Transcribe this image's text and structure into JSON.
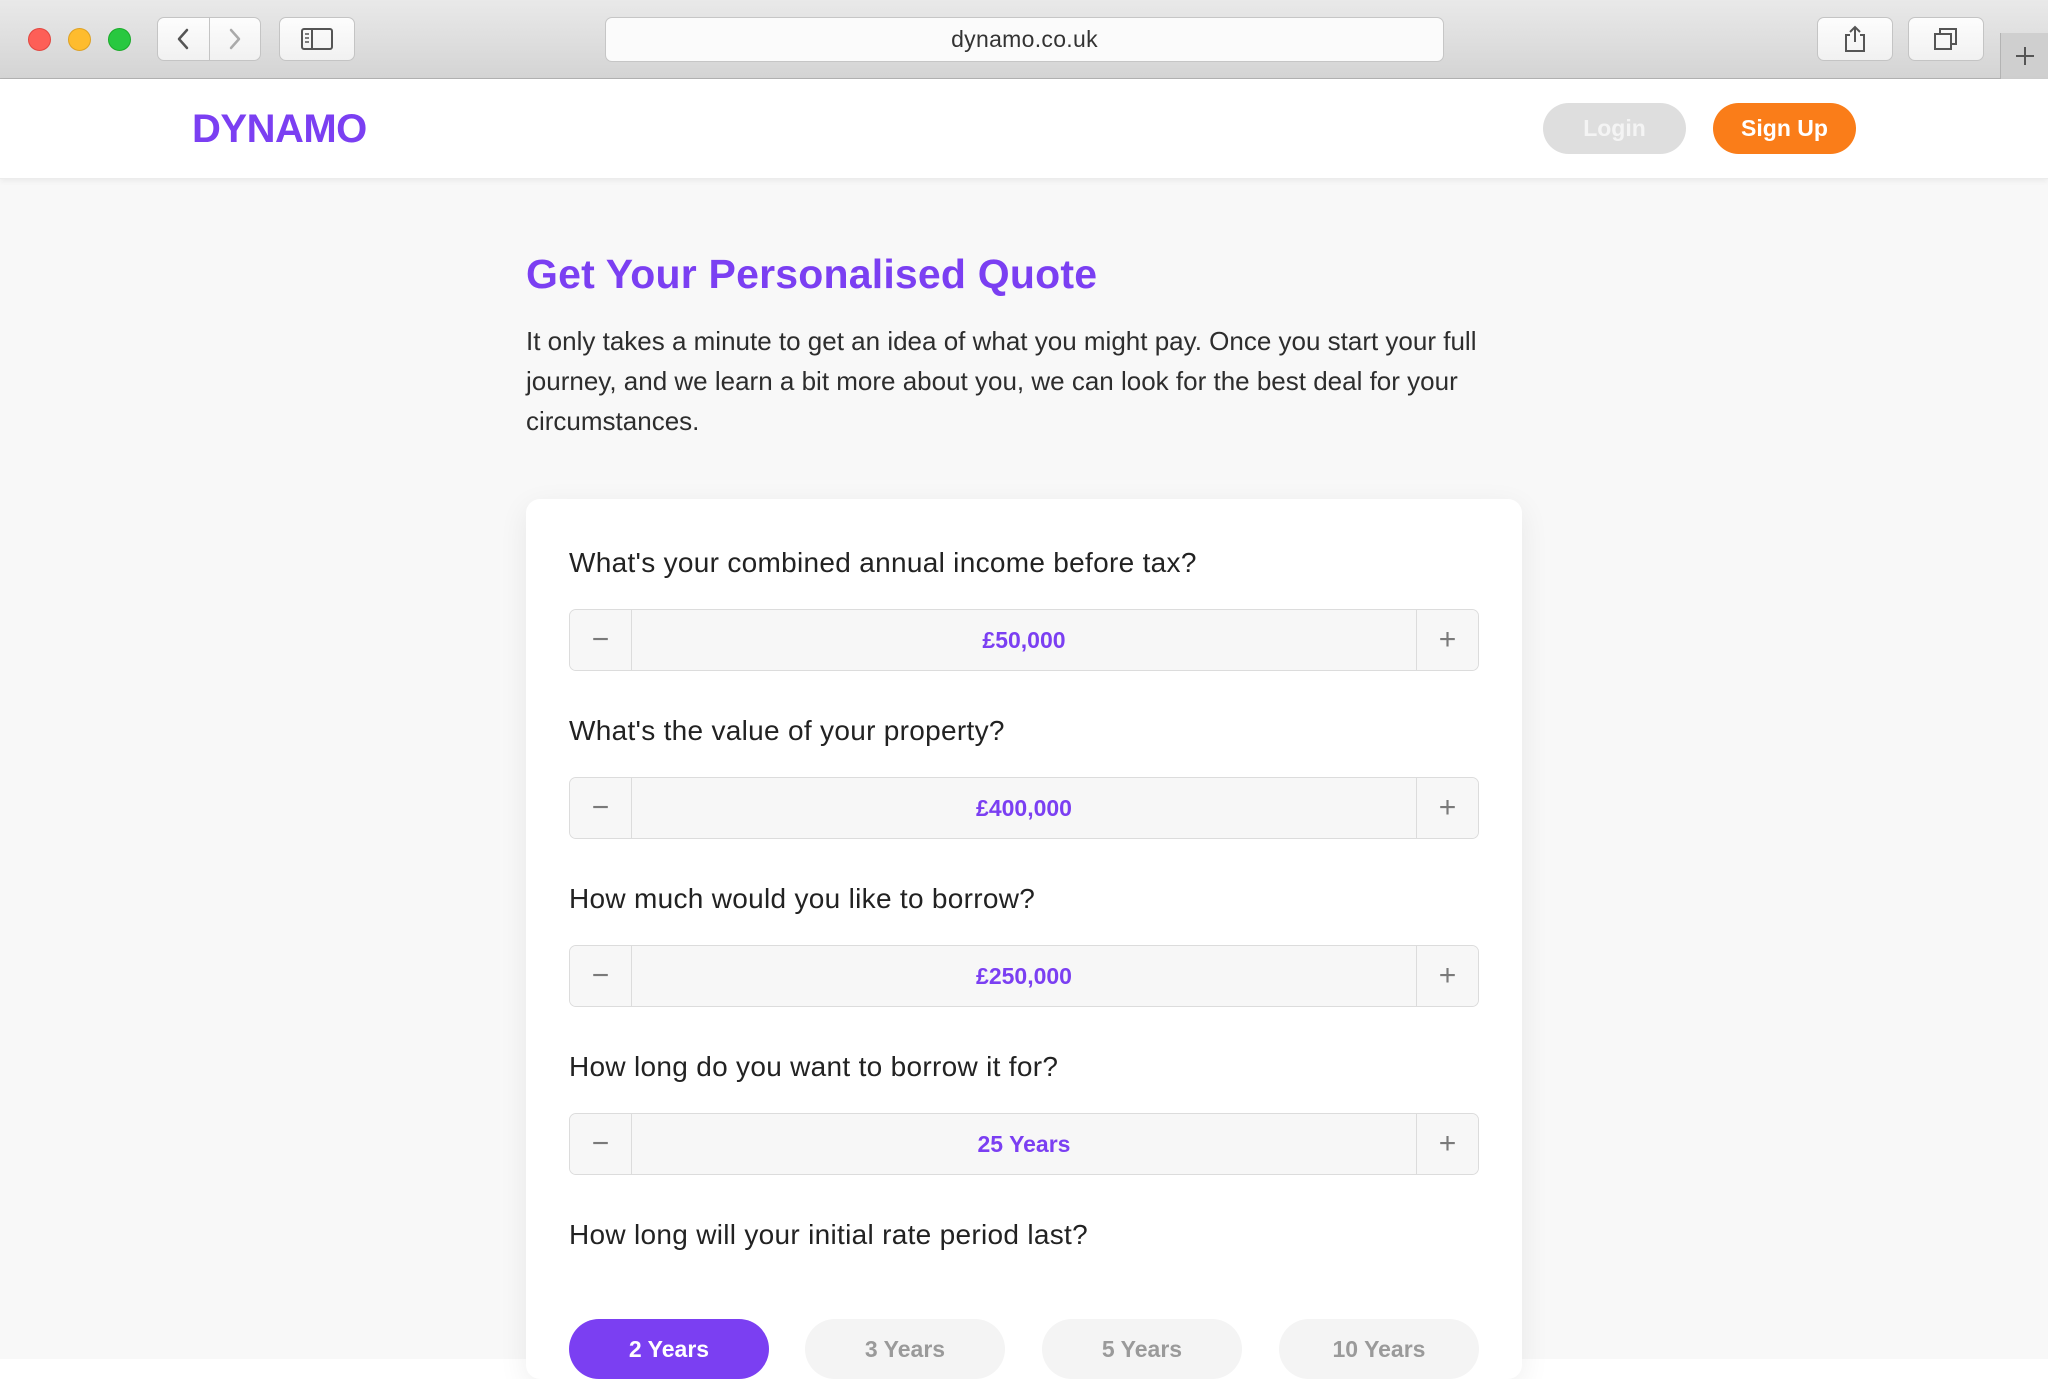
{
  "browser": {
    "url": "dynamo.co.uk"
  },
  "header": {
    "logo": "DYNAMO",
    "login_label": "Login",
    "signup_label": "Sign Up"
  },
  "main": {
    "title": "Get Your Personalised Quote",
    "intro": "It only takes a minute to get an idea of what you might pay. Once you start your full journey, and we learn a bit more about you, we can look for the best deal for your circumstances.",
    "questions": [
      {
        "label": "What's your combined annual income before tax?",
        "value": "£50,000"
      },
      {
        "label": "What's the value of your property?",
        "value": "£400,000"
      },
      {
        "label": "How much would you like to borrow?",
        "value": "£250,000"
      },
      {
        "label": "How long do you want to borrow it for?",
        "value": "25 Years"
      }
    ],
    "rate_period": {
      "label": "How long will your initial rate period last?",
      "options": [
        "2 Years",
        "3 Years",
        "5 Years",
        "10 Years"
      ],
      "selected": "2 Years"
    }
  },
  "colors": {
    "brand_purple": "#7b3ff2",
    "brand_orange": "#fa7d19",
    "muted_button": "#dedede"
  },
  "icons": [
    "back-icon",
    "forward-icon",
    "sidebar-icon",
    "share-icon",
    "tabs-icon",
    "new-tab-icon",
    "minus-icon",
    "plus-icon"
  ]
}
